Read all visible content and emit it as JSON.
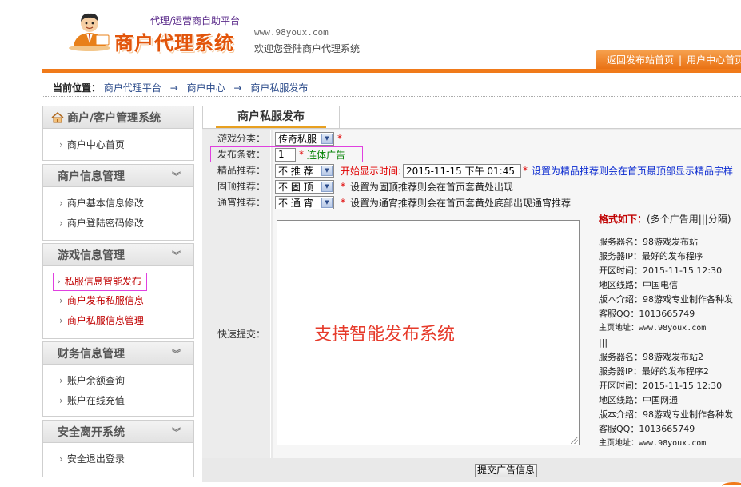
{
  "header": {
    "platform_subtitle": "代理/运营商自助平台",
    "title": "商户代理系统",
    "url": "www.98youx.com",
    "welcome": "欢迎您登陆商户代理系统",
    "top_links": [
      "返回发布站首页",
      "用户中心首页"
    ]
  },
  "breadcrumb": {
    "label": "当前位置：",
    "items": [
      "商户代理平台",
      "商户中心",
      "商户私服发布"
    ],
    "separator": "→"
  },
  "sidebar": [
    {
      "title": "商户/客户管理系统",
      "icon": "home-icon",
      "items": [
        "商户中心首页"
      ]
    },
    {
      "title": "商户信息管理",
      "items": [
        "商户基本信息修改",
        "商户登陆密码修改"
      ]
    },
    {
      "title": "游戏信息管理",
      "items": [
        "私服信息智能发布",
        "商户发布私服信息",
        "商户私服信息管理"
      ]
    },
    {
      "title": "财务信息管理",
      "items": [
        "账户余额查询",
        "账户在线充值"
      ]
    },
    {
      "title": "安全离开系统",
      "items": [
        "安全退出登录"
      ]
    }
  ],
  "main": {
    "tab_title": "商户私服发布",
    "form": {
      "game_type_label": "游戏分类：",
      "game_type_value": "传奇私服",
      "count_label": "发布条数：",
      "count_value": "1",
      "count_hint": "连体广告",
      "featured_label": "精品推荐：",
      "featured_value": "不 推 荐",
      "start_time_label": "开始显示时间:",
      "start_time_value": "2015-11-15 下午 01:45",
      "featured_hint": "设置为精品推荐则会在首页最顶部显示精品字样",
      "pinned_label": "固顶推荐：",
      "pinned_value": "不 固 顶",
      "pinned_hint": "设置为固顶推荐则会在首页套黄处出现",
      "banner_label": "通宵推荐：",
      "banner_value": "不 通 宵",
      "banner_hint": "设置为通宵推荐则会在首页套黄处底部出现通宵推荐",
      "quick_submit_label": "快速提交：",
      "textarea_text": "支持智能发布系统",
      "format_title": "格式如下：",
      "format_sub": "(多个广告用|||分隔)",
      "format_lines": [
        "服务器名：98游戏发布站",
        "服务器IP：最好的发布程序",
        "开区时间：2015-11-15 12:30",
        "地区线路：中国电信",
        "版本介绍：98游戏专业制作各种发",
        "客服QQ：1013665749",
        "主页地址：www.98youx.com",
        "|||",
        "服务器名：98游戏发布站2",
        "服务器IP：最好的发布程序2",
        "开区时间：2015-11-15 12:30",
        "地区线路：中国网通",
        "版本介绍：98游戏专业制作各种发",
        "客服QQ：1013665749",
        "主页地址：www.98youx.com"
      ],
      "submit_label": "提交广告信息"
    }
  },
  "colors": {
    "accent": "#f07a1a",
    "link": "#2a4a8a",
    "required": "#e00000"
  }
}
